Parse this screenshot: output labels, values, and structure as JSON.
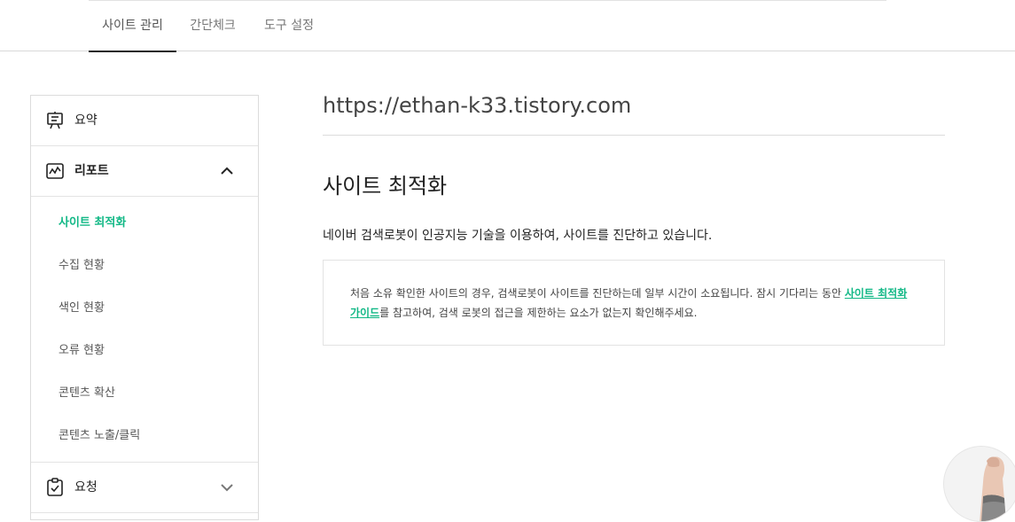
{
  "nav": {
    "tabs": [
      {
        "label": "사이트 관리",
        "active": true
      },
      {
        "label": "간단체크",
        "active": false
      },
      {
        "label": "도구 설정",
        "active": false
      }
    ]
  },
  "sidebar": {
    "summary_label": "요약",
    "report_label": "리포트",
    "report_items": [
      {
        "label": "사이트 최적화",
        "active": true
      },
      {
        "label": "수집 현황",
        "active": false
      },
      {
        "label": "색인 현황",
        "active": false
      },
      {
        "label": "오류 현황",
        "active": false
      },
      {
        "label": "콘텐츠 확산",
        "active": false
      },
      {
        "label": "콘텐츠 노출/클릭",
        "active": false
      }
    ],
    "request_label": "요청"
  },
  "main": {
    "site_url": "https://ethan-k33.tistory.com",
    "title": "사이트 최적화",
    "description": "네이버 검색로봇이 인공지능 기술을 이용하여, 사이트를 진단하고 있습니다.",
    "notice_before": "처음 소유 확인한 사이트의 경우, 검색로봇이 사이트를 진단하는데 일부 시간이 소요됩니다. 잠시 기다리는 동안 ",
    "notice_link": "사이트 최적화 가이드",
    "notice_after": "를 참고하여, 검색 로봇의 접근을 제한하는 요소가 없는지 확인해주세요."
  },
  "colors": {
    "accent": "#12b886",
    "text": "#222222",
    "border": "#dcdcdc"
  },
  "icons": [
    "summary-board-icon",
    "report-chart-icon",
    "chevron-up-icon",
    "request-clipboard-check-icon",
    "chevron-down-icon",
    "avatar-hand-icon"
  ]
}
